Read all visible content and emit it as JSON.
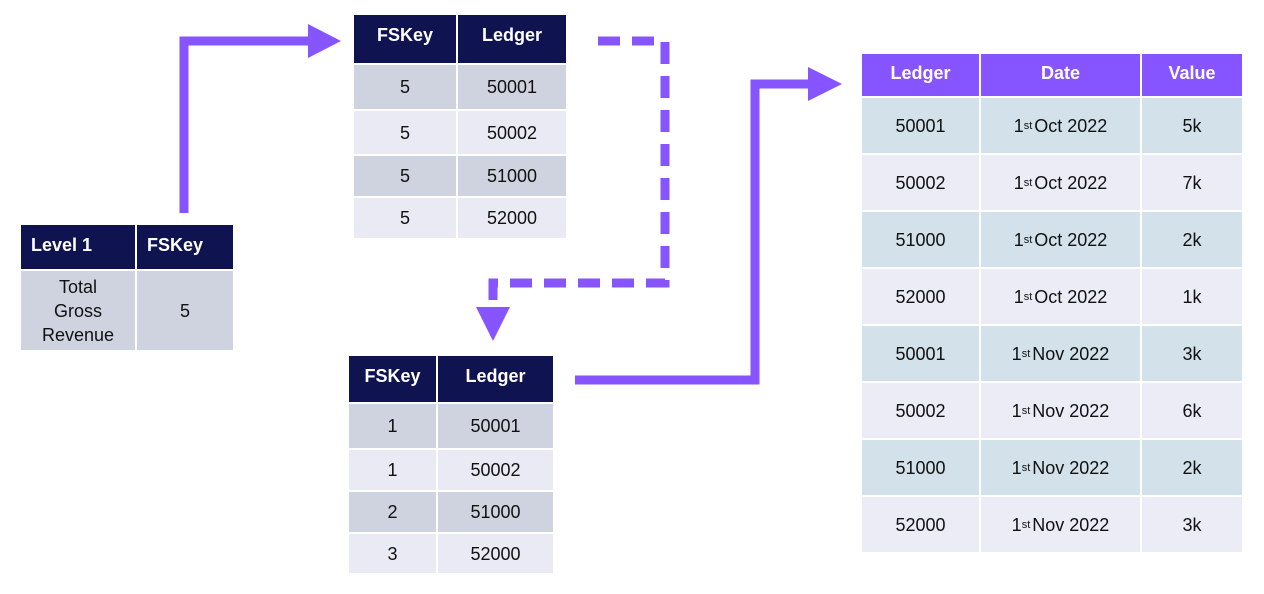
{
  "colors": {
    "header_dark": "#0f1450",
    "header_accent": "#8755ff",
    "arrow": "#8755ff"
  },
  "level_table": {
    "headers": [
      "Level 1",
      "FSKey"
    ],
    "rows": [
      [
        "Total Gross Revenue",
        "5"
      ]
    ]
  },
  "fskey_table_top": {
    "headers": [
      "FSKey",
      "Ledger"
    ],
    "rows": [
      [
        "5",
        "50001"
      ],
      [
        "5",
        "50002"
      ],
      [
        "5",
        "51000"
      ],
      [
        "5",
        "52000"
      ]
    ]
  },
  "fskey_table_bottom": {
    "headers": [
      "FSKey",
      "Ledger"
    ],
    "rows": [
      [
        "1",
        "50001"
      ],
      [
        "1",
        "50002"
      ],
      [
        "2",
        "51000"
      ],
      [
        "3",
        "52000"
      ]
    ]
  },
  "ledger_table": {
    "headers": [
      "Ledger",
      "Date",
      "Value"
    ],
    "rows": [
      {
        "ledger": "50001",
        "day": "1",
        "suffix": "st",
        "date": "Oct 2022",
        "value": "5k"
      },
      {
        "ledger": "50002",
        "day": "1",
        "suffix": "st",
        "date": "Oct 2022",
        "value": "7k"
      },
      {
        "ledger": "51000",
        "day": "1",
        "suffix": "st",
        "date": "Oct 2022",
        "value": "2k"
      },
      {
        "ledger": "52000",
        "day": "1",
        "suffix": "st",
        "date": "Oct 2022",
        "value": "1k"
      },
      {
        "ledger": "50001",
        "day": "1",
        "suffix": "st",
        "date": "Nov 2022",
        "value": "3k"
      },
      {
        "ledger": "50002",
        "day": "1",
        "suffix": "st",
        "date": "Nov 2022",
        "value": "6k"
      },
      {
        "ledger": "51000",
        "day": "1",
        "suffix": "st",
        "date": "Nov 2022",
        "value": "2k"
      },
      {
        "ledger": "52000",
        "day": "1",
        "suffix": "st",
        "date": "Nov 2022",
        "value": "3k"
      }
    ]
  }
}
